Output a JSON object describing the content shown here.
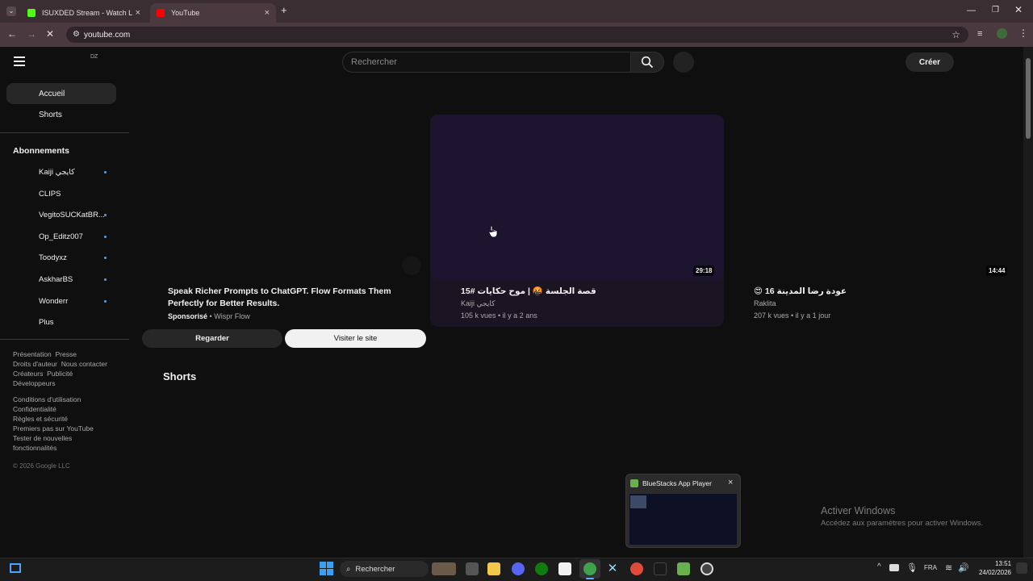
{
  "browser": {
    "tabs": [
      {
        "label": "ISUXDED Stream - Watch Live o",
        "icon": "kick-icon",
        "color": "#53fc18"
      },
      {
        "label": "YouTube",
        "icon": "youtube-icon",
        "color": "#ff0000"
      }
    ],
    "new_tab": "+",
    "url": "youtube.com"
  },
  "yt": {
    "region": "DZ",
    "search_placeholder": "Rechercher",
    "create_label": "Créer",
    "nav": [
      {
        "label": "Accueil",
        "active": true
      },
      {
        "label": "Shorts",
        "active": false
      }
    ],
    "subscriptions_heading": "Abonnements",
    "subscriptions": [
      {
        "label": "Kaiji كايجي",
        "new": true
      },
      {
        "label": "CLIPS",
        "new": false
      },
      {
        "label": "VegitoSUCKatBR...",
        "new": true
      },
      {
        "label": "Op_Editz007",
        "new": true
      },
      {
        "label": "Toodyxz",
        "new": true
      },
      {
        "label": "AskharBS",
        "new": true
      },
      {
        "label": "Wonderr",
        "new": true
      },
      {
        "label": "Plus",
        "new": false
      }
    ],
    "footer": {
      "row1": [
        "Présentation",
        "Presse"
      ],
      "row2": [
        "Droits d'auteur",
        "Nous contacter"
      ],
      "row3": [
        "Créateurs",
        "Publicité"
      ],
      "row4": [
        "Développeurs"
      ],
      "row5": [
        "Conditions d'utilisation",
        "Confidentialité",
        "Règles et sécurité",
        "Premiers pas sur YouTube",
        "Tester de nouvelles fonctionnalités"
      ],
      "copyright": "© 2026 Google LLC"
    },
    "ad": {
      "title": "Speak Richer Prompts to ChatGPT. Flow Formats Them Perfectly for Better Results.",
      "sponsored": "Sponsorisé",
      "sep": "•",
      "advertiser": "Wispr Flow",
      "watch_label": "Regarder",
      "visit_label": "Visiter le site"
    },
    "videos": [
      {
        "title": "قصة الجلسة 🤬 | موح حكايات #15",
        "channel": "Kaiji كايجي",
        "views": "105 k vues • il y a 2 ans",
        "duration": "29:18"
      },
      {
        "title": "😍 16 عودة رضا المدينة",
        "channel": "Raklita",
        "views": "207 k vues • il y a 1 jour",
        "duration": "14:44"
      }
    ],
    "shorts_heading": "Shorts"
  },
  "popup": {
    "title": "BlueStacks App Player",
    "close": "×"
  },
  "watermark": {
    "line1": "Activer Windows",
    "line2": "Accédez aux paramètres pour activer Windows."
  },
  "taskbar": {
    "search_label": "Rechercher",
    "lang": "FRA",
    "time": "13:51",
    "date": "24/02/2026"
  }
}
